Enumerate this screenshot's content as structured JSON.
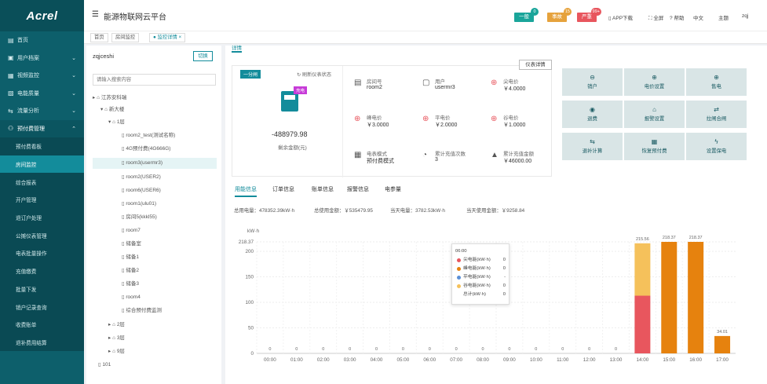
{
  "app": {
    "logo": "Acrel",
    "title": "能源物联网云平台"
  },
  "header": {
    "alarms": [
      {
        "label": "一般",
        "count": "0",
        "color": "#1aa59a",
        "badge": "#1aa59a"
      },
      {
        "label": "事故",
        "count": "15",
        "color": "#e6a23c",
        "badge": "#e6a23c"
      },
      {
        "label": "严重",
        "count": "99+",
        "color": "#e8565e",
        "badge": "#e8565e"
      }
    ],
    "app_download": "APP下载",
    "fullscreen": "全屏",
    "help": "帮助",
    "lang": "中文",
    "theme": "主题",
    "user": "zqj"
  },
  "sidebar": {
    "items": [
      {
        "label": "首页",
        "icon": "▤"
      },
      {
        "label": "用户档案",
        "icon": "▣"
      },
      {
        "label": "视频监控",
        "icon": "▦"
      },
      {
        "label": "电能质量",
        "icon": "▧"
      },
      {
        "label": "流量分析",
        "icon": "⇆"
      },
      {
        "label": "预付费管理",
        "icon": "⚇"
      }
    ],
    "subitems": [
      "预付费看板",
      "房间监控",
      "综合报表",
      "开户管理",
      "退订户处理",
      "公摊仪表管理",
      "电表批量操作",
      "充值缴费",
      "批量下发",
      "销户记录查询",
      "收费账单",
      "退补费用结算"
    ]
  },
  "crumbs": [
    "首页",
    "房间监控",
    "监控详情"
  ],
  "tree": {
    "user": "zqjceshi",
    "switch_btn": "切换",
    "search_placeholder": "请输入搜索内容",
    "nodes": [
      "江苏安科瑞",
      "新大楼",
      "1层",
      "room2_test(测试名称)",
      "4G预付费(4G666G)",
      "room3(usermr3)",
      "room2(USER2)",
      "room6(USER6)",
      "room1(ulu01)",
      "房间5(kkkl55)",
      "room7",
      "储备室",
      "储备1",
      "储备2",
      "储备3",
      "room4",
      "综合预付费监测",
      "2层",
      "3层",
      "9层",
      "101"
    ]
  },
  "info": {
    "tab": "详情",
    "status_tag": "一分闸",
    "refresh": "刷新仪表状态",
    "meter_detail": "仪表详情",
    "meter_badge": "充电",
    "balance": "-488979.98",
    "balance_label": "剩余金额(元)",
    "fields": [
      {
        "label": "房间号",
        "value": "room2"
      },
      {
        "label": "用户",
        "value": "usermr3"
      },
      {
        "label": "尖电价",
        "value": "￥4.0000"
      },
      {
        "label": "峰电价",
        "value": "￥3.0000"
      },
      {
        "label": "平电价",
        "value": "￥2.0000"
      },
      {
        "label": "谷电价",
        "value": "￥1.0000"
      },
      {
        "label": "电表模式",
        "value": "预付费模式"
      },
      {
        "label": "累计充值次数",
        "value": "3"
      },
      {
        "label": "累计充值金额",
        "value": "￥46000.00"
      }
    ],
    "actions": [
      "销户",
      "电价设置",
      "售电",
      "退费",
      "报警设置",
      "拉闸合闸",
      "退补计算",
      "恢复预付费",
      "设置保电"
    ]
  },
  "tabs": [
    "用能信息",
    "订单信息",
    "账单信息",
    "报警信息",
    "电参量"
  ],
  "summary": [
    "总用电量：478352.39kW·h",
    "总使用金额：￥535479.95",
    "当天电量：3782.53kW·h",
    "当天使用金额：￥9258.84"
  ],
  "tooltip": {
    "time": "06:00",
    "rows": [
      {
        "name": "尖电能(kW·h)",
        "value": "0",
        "color": "#e8565e"
      },
      {
        "name": "峰电能(kW·h)",
        "value": "0",
        "color": "#e6820e"
      },
      {
        "name": "平电能(kW·h)",
        "value": "-",
        "color": "#5b8fd6"
      },
      {
        "name": "谷电能(kW·h)",
        "value": "0",
        "color": "#f5c15b"
      },
      {
        "name": "总计(kW·h)",
        "value": "0",
        "color": ""
      }
    ]
  },
  "chart_data": {
    "type": "bar",
    "ylabel": "kW·h",
    "ylim": [
      0,
      218.37
    ],
    "yticks": [
      0,
      50,
      100,
      150,
      200,
      218.37
    ],
    "categories": [
      "00:00",
      "01:00",
      "02:00",
      "03:00",
      "04:00",
      "05:00",
      "06:00",
      "07:00",
      "08:00",
      "09:00",
      "10:00",
      "11:00",
      "12:00",
      "13:00",
      "14:00",
      "15:00",
      "16:00",
      "17:00"
    ],
    "totals_label": [
      "0",
      "0",
      "0",
      "0",
      "0",
      "0",
      "0",
      "0",
      "0",
      "0",
      "0",
      "0",
      "0",
      "0",
      "215.56",
      "218.37",
      "218.37",
      "34.01"
    ],
    "series": [
      {
        "name": "尖电能(kW·h)",
        "color": "#e8565e",
        "values": [
          0,
          0,
          0,
          0,
          0,
          0,
          0,
          0,
          0,
          0,
          0,
          0,
          0,
          0,
          113,
          0,
          0,
          0
        ]
      },
      {
        "name": "峰电能(kW·h)",
        "color": "#e6820e",
        "values": [
          0,
          0,
          0,
          0,
          0,
          0,
          0,
          0,
          0,
          0,
          0,
          0,
          0,
          0,
          0,
          218.37,
          218.37,
          34.01
        ]
      },
      {
        "name": "平电能(kW·h)",
        "color": "#5b8fd6",
        "values": [
          0,
          0,
          0,
          0,
          0,
          0,
          0,
          0,
          0,
          0,
          0,
          0,
          0,
          0,
          0,
          0,
          0,
          0
        ]
      },
      {
        "name": "谷电能(kW·h)",
        "color": "#f5c15b",
        "values": [
          0,
          0,
          0,
          0,
          0,
          0,
          0,
          0,
          0,
          0,
          0,
          0,
          0,
          0,
          102.56,
          0,
          0,
          0
        ]
      }
    ]
  }
}
